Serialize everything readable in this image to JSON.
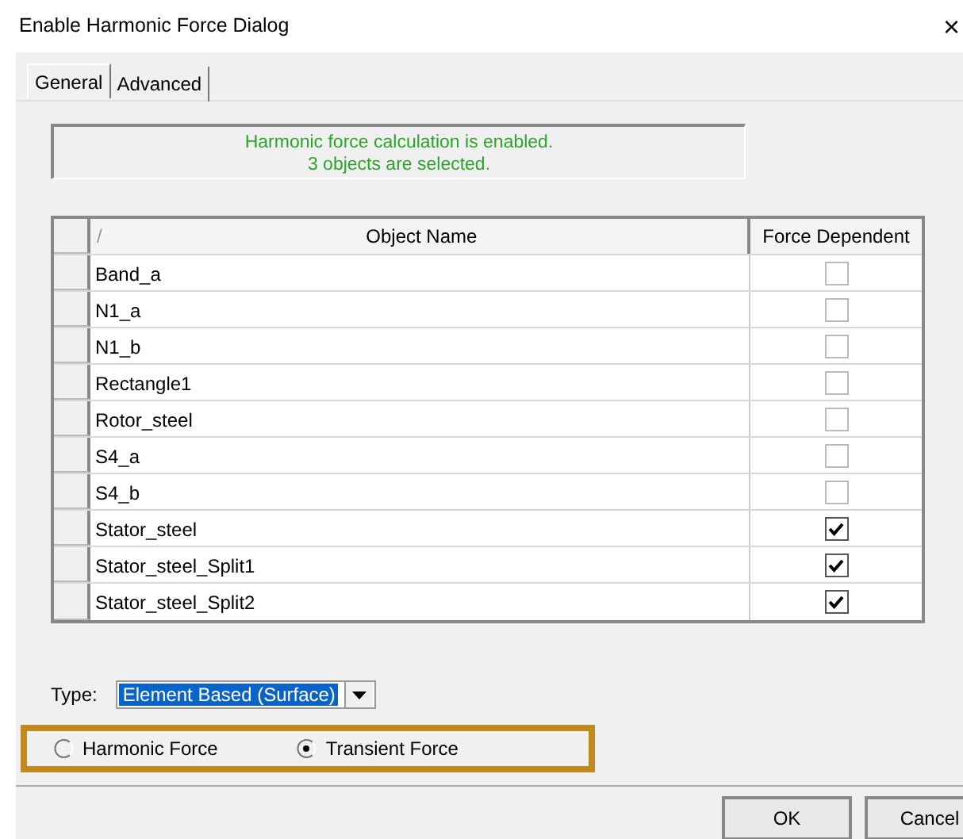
{
  "window": {
    "title": "Enable Harmonic Force Dialog",
    "close": "×"
  },
  "tabs": [
    {
      "label": "General",
      "selected": true
    },
    {
      "label": "Advanced",
      "selected": false
    }
  ],
  "message": {
    "lines": [
      "Harmonic force calculation is enabled.",
      "3 objects are selected."
    ]
  },
  "table": {
    "sort_mark": "/",
    "columns": [
      "Object Name",
      "Force Dependent"
    ],
    "rows": [
      {
        "name": "Band_a",
        "checked": false
      },
      {
        "name": "N1_a",
        "checked": false
      },
      {
        "name": "N1_b",
        "checked": false
      },
      {
        "name": "Rectangle1",
        "checked": false
      },
      {
        "name": "Rotor_steel",
        "checked": false
      },
      {
        "name": "S4_a",
        "checked": false
      },
      {
        "name": "S4_b",
        "checked": false
      },
      {
        "name": "Stator_steel",
        "checked": true
      },
      {
        "name": "Stator_steel_Split1",
        "checked": true
      },
      {
        "name": "Stator_steel_Split2",
        "checked": true
      }
    ]
  },
  "type_field": {
    "label": "Type:",
    "value": "Element Based (Surface)",
    "focused": true
  },
  "force_mode": {
    "highlighted": true,
    "options": [
      {
        "label": "Harmonic Force",
        "selected": false
      },
      {
        "label": "Transient Force",
        "selected": true
      }
    ]
  },
  "buttons": [
    "OK",
    "Cancel"
  ]
}
